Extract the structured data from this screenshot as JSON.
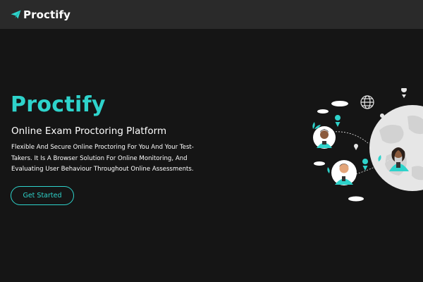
{
  "nav": {
    "brand": "Proctify",
    "logo_icon": "paper-plane-icon"
  },
  "hero": {
    "title": "Proctify",
    "subtitle": "Online Exam Proctoring Platform",
    "description": "Flexible And Secure Online Proctoring For You And Your Test-Takers. It Is A Browser Solution For Online Monitoring, And Evaluating User Behaviour Throughout Online Assessments.",
    "cta_label": "Get Started"
  },
  "colors": {
    "accent": "#2ed3cb",
    "background": "#151515",
    "navbar": "#2a2a2a"
  }
}
